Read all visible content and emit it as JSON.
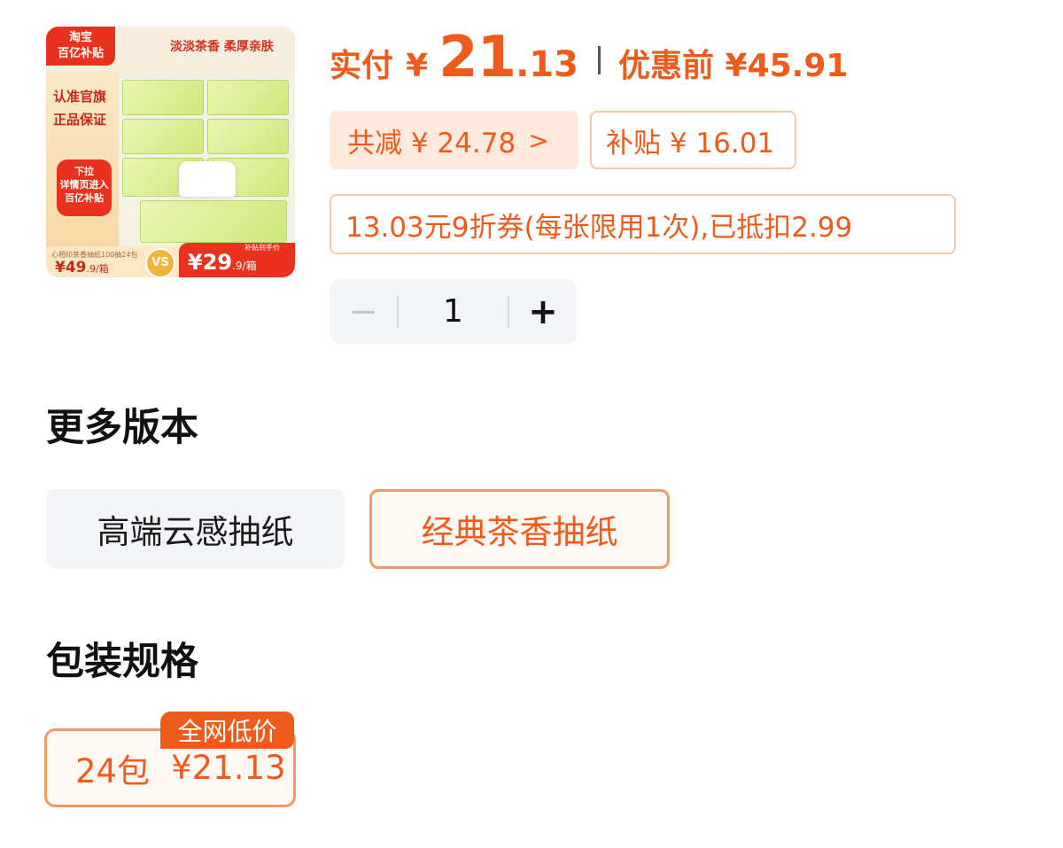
{
  "thumbnail": {
    "logo": "淘宝\n百亿补贴",
    "slogan": "淡淡茶香 柔厚亲肤",
    "auth": "认准官旗\n正品保证",
    "pill": "下拉\n详情页进入\n百亿补贴",
    "subtitle": "心相印茶香抽纸100抽24包",
    "old_price": "49",
    "old_suffix": ".9/箱",
    "vs": "VS",
    "new_tag": "补贴到手价",
    "new_price": "29",
    "new_suffix": ".9/箱"
  },
  "price": {
    "paid_label": "实付",
    "yen": "¥",
    "paid_int": "21",
    "paid_dec": ".13",
    "original": "优惠前 ¥45.91"
  },
  "discounts": {
    "total": "共减 ¥ 24.78",
    "total_chevron": ">",
    "subsidy": "补贴 ¥ 16.01",
    "coupon": "13.03元9折券(每张限用1次),已抵扣2.99"
  },
  "quantity": {
    "minus": "−",
    "value": "1",
    "plus": "+"
  },
  "versions": {
    "title": "更多版本",
    "options": [
      "高端云感抽纸",
      "经典茶香抽纸"
    ],
    "selected": 1
  },
  "packaging": {
    "title": "包装规格",
    "option_label": "24包",
    "option_price": "¥21.13",
    "badge": "全网低价"
  },
  "colors": {
    "accent": "#f05a1a",
    "accent_light": "#fdeadd",
    "border_accent": "#f29a63",
    "neutral_bg": "#f3f4f7"
  }
}
